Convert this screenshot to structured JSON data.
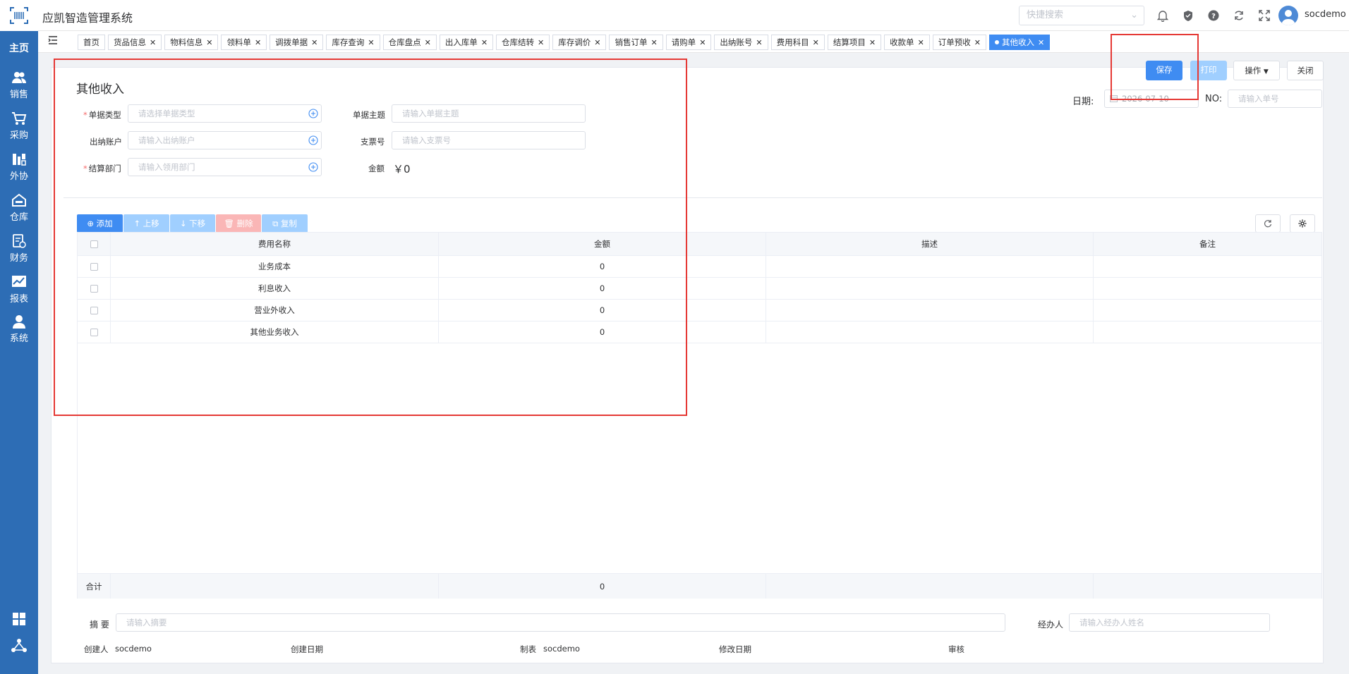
{
  "app": {
    "title": "应凯智造管理系统",
    "username": "socdemo"
  },
  "search": {
    "placeholder": "快捷搜索"
  },
  "sidebar": {
    "items": [
      {
        "label": "主页"
      },
      {
        "label": "销售"
      },
      {
        "label": "采购"
      },
      {
        "label": "外协"
      },
      {
        "label": "仓库"
      },
      {
        "label": "财务"
      },
      {
        "label": "报表"
      },
      {
        "label": "系统"
      }
    ]
  },
  "tabs": [
    {
      "label": "首页"
    },
    {
      "label": "货品信息"
    },
    {
      "label": "物料信息"
    },
    {
      "label": "领料单"
    },
    {
      "label": "调拨单据"
    },
    {
      "label": "库存查询"
    },
    {
      "label": "仓库盘点"
    },
    {
      "label": "出入库单"
    },
    {
      "label": "仓库结转"
    },
    {
      "label": "库存调价"
    },
    {
      "label": "销售订单"
    },
    {
      "label": "请购单"
    },
    {
      "label": "出纳账号"
    },
    {
      "label": "费用科目"
    },
    {
      "label": "结算项目"
    },
    {
      "label": "收款单"
    },
    {
      "label": "订单预收"
    },
    {
      "label": "其他收入"
    }
  ],
  "actions": {
    "save": "保存",
    "print": "打印",
    "ops": "操作",
    "close": "关闭"
  },
  "form": {
    "title": "其他收入",
    "doc_type_label": "单据类型",
    "doc_type_placeholder": "请选择单据类型",
    "subject_label": "单据主题",
    "subject_placeholder": "请输入单据主题",
    "account_label": "出纳账户",
    "account_placeholder": "请输入出纳账户",
    "cheque_label": "支票号",
    "cheque_placeholder": "请输入支票号",
    "dept_label": "结算部门",
    "dept_placeholder": "请输入领用部门",
    "amount_label": "金额",
    "amount_value": "￥0",
    "date_label": "日期:",
    "date_value": "2026-07-10",
    "no_label": "NO:",
    "no_placeholder": "请输入单号"
  },
  "toolbar": {
    "add": "添加",
    "up": "上移",
    "down": "下移",
    "delete": "删除",
    "copy": "复制"
  },
  "table": {
    "headers": [
      "费用名称",
      "金额",
      "描述",
      "备注"
    ],
    "rows": [
      {
        "name": "业务成本",
        "amount": "0",
        "desc": "",
        "note": ""
      },
      {
        "name": "利息收入",
        "amount": "0",
        "desc": "",
        "note": ""
      },
      {
        "name": "营业外收入",
        "amount": "0",
        "desc": "",
        "note": ""
      },
      {
        "name": "其他业务收入",
        "amount": "0",
        "desc": "",
        "note": ""
      }
    ],
    "total_label": "合计",
    "total_amount": "0"
  },
  "footer": {
    "summary_label": "摘 要",
    "summary_placeholder": "请输入摘要",
    "handler_label": "经办人",
    "handler_placeholder": "请输入经办人姓名",
    "creator_label": "创建人",
    "creator_value": "socdemo",
    "created_label": "创建日期",
    "created_value": "",
    "maker_label": "制表",
    "maker_value": "socdemo",
    "modified_label": "修改日期",
    "modified_value": "",
    "audit_label": "审核",
    "audit_value": ""
  },
  "colors": {
    "sidebar": "#2d6db5",
    "primary": "#3f8cf2",
    "danger_light": "#fab6b6",
    "highlight": "#e53935"
  }
}
